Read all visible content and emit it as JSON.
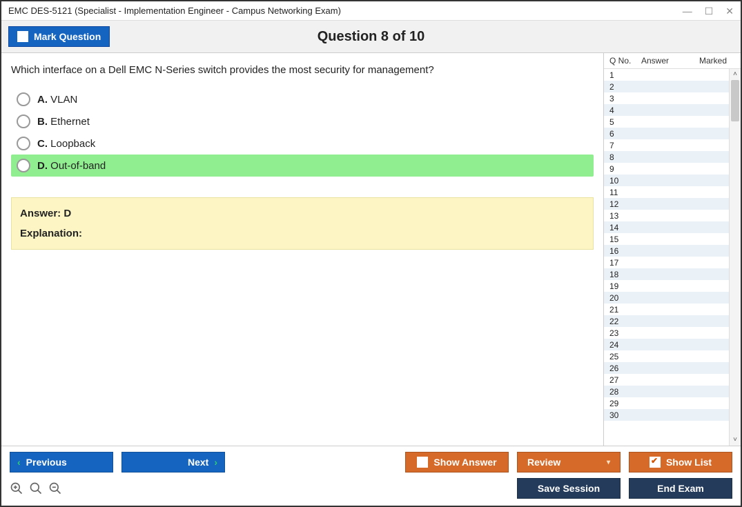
{
  "window": {
    "title": "EMC DES-5121 (Specialist - Implementation Engineer - Campus Networking Exam)"
  },
  "header": {
    "mark_label": "Mark Question",
    "counter": "Question 8 of 10"
  },
  "question": {
    "text": "Which interface on a Dell EMC N-Series switch provides the most security for management?",
    "options": [
      {
        "letter": "A.",
        "text": "VLAN",
        "highlight": false
      },
      {
        "letter": "B.",
        "text": "Ethernet",
        "highlight": false
      },
      {
        "letter": "C.",
        "text": "Loopback",
        "highlight": false
      },
      {
        "letter": "D.",
        "text": "Out-of-band",
        "highlight": true
      }
    ],
    "answer_label": "Answer:",
    "answer_value": "D",
    "explanation_label": "Explanation:",
    "explanation_text": ""
  },
  "sidebar": {
    "head": {
      "qno": "Q No.",
      "answer": "Answer",
      "marked": "Marked"
    },
    "rows": [
      1,
      2,
      3,
      4,
      5,
      6,
      7,
      8,
      9,
      10,
      11,
      12,
      13,
      14,
      15,
      16,
      17,
      18,
      19,
      20,
      21,
      22,
      23,
      24,
      25,
      26,
      27,
      28,
      29,
      30
    ]
  },
  "footer": {
    "previous": "Previous",
    "next": "Next",
    "show_answer": "Show Answer",
    "review": "Review",
    "show_list": "Show List",
    "save_session": "Save Session",
    "end_exam": "End Exam"
  }
}
